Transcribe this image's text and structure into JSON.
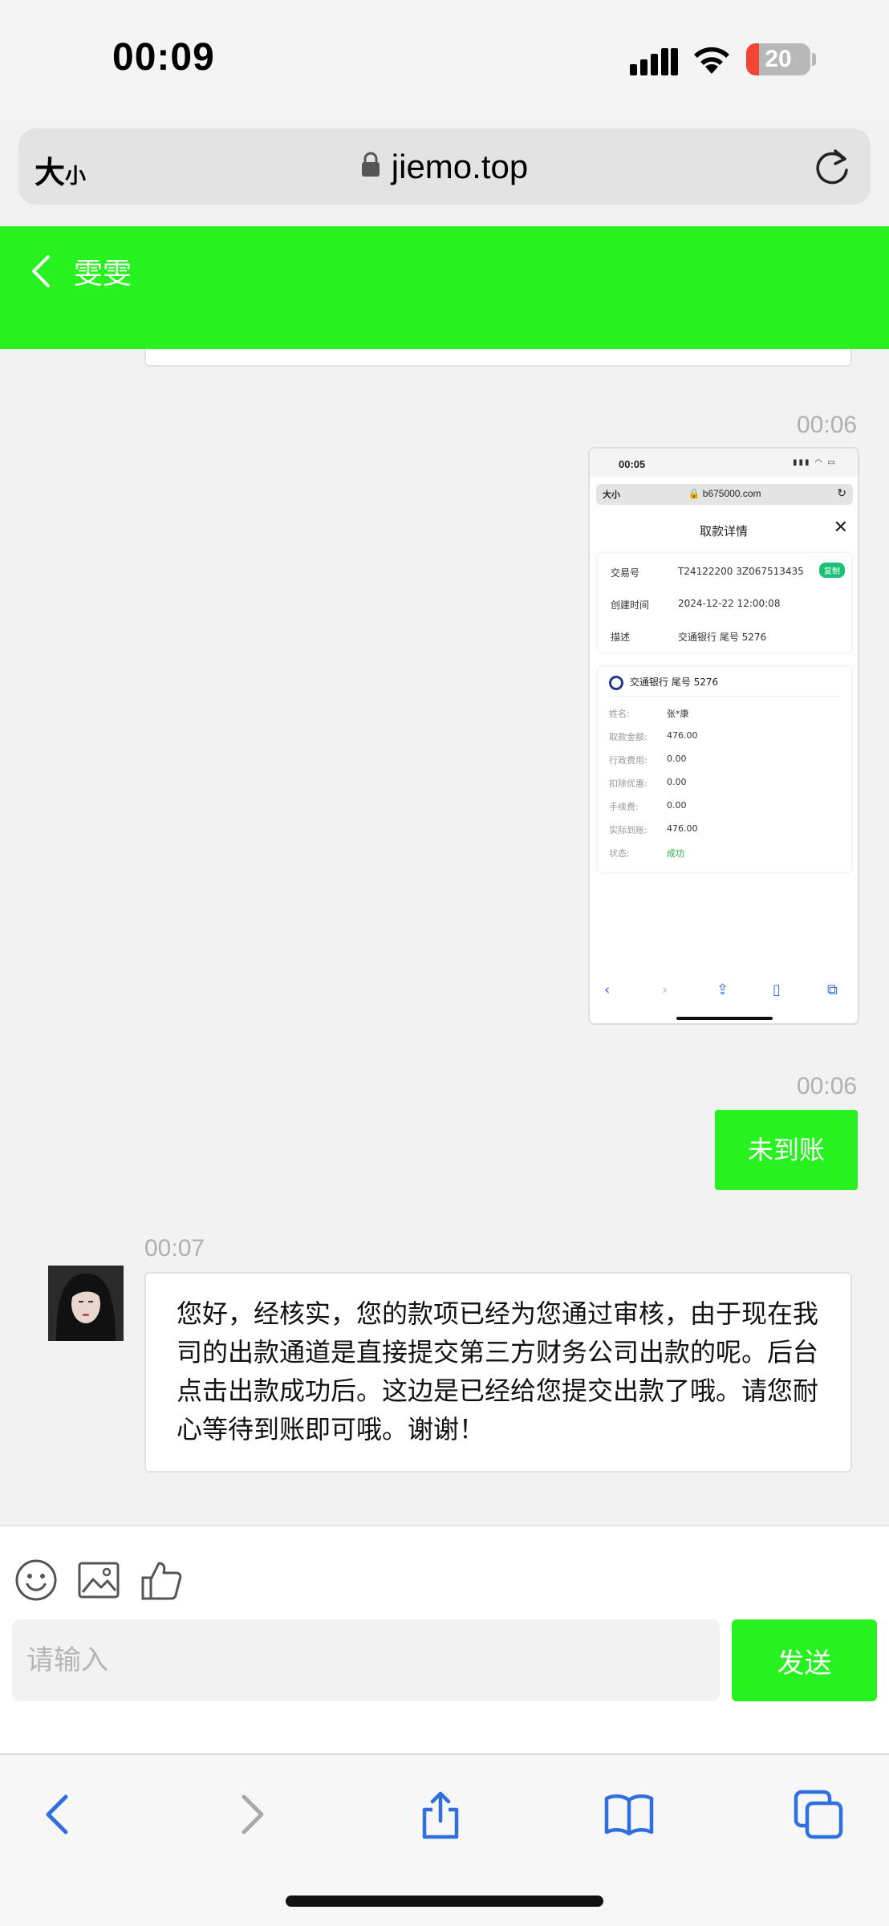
{
  "status_bar": {
    "time": "00:09",
    "battery_level": "20",
    "battery_color": "#f04637"
  },
  "browser": {
    "text_size_large": "大",
    "text_size_small": "小",
    "url": "jiemo.top"
  },
  "chat": {
    "header_color": "#27f11f",
    "title": "雯雯",
    "messages": [
      {
        "time": "00:06",
        "type": "image",
        "from": "me"
      },
      {
        "time": "00:06",
        "type": "text",
        "from": "me",
        "text": "未到账"
      },
      {
        "time": "00:07",
        "type": "text",
        "from": "them",
        "text": "您好，经核实，您的款项已经为您通过审核，由于现在我司的出款通道是直接提交第三方财务公司出款的呢。后台点击出款成功后。这边是已经给您提交出款了哦。请您耐心等待到账即可哦。谢谢！"
      }
    ]
  },
  "embedded_screenshot": {
    "time": "00:05",
    "url": "b675000.com",
    "text_size": "大小",
    "title": "取款详情",
    "copy_label": "复制",
    "details": [
      {
        "label": "交易号",
        "value": "T24122200 3Z067513435"
      },
      {
        "label": "创建时间",
        "value": "2024-12-22 12:00:08"
      },
      {
        "label": "描述",
        "value": "交通银行 尾号 5276"
      }
    ],
    "bank_name": "交通银行 尾号 5276",
    "rows": [
      {
        "label": "姓名:",
        "value": "张*康"
      },
      {
        "label": "取款金额:",
        "value": "476.00"
      },
      {
        "label": "行政费用:",
        "value": "0.00"
      },
      {
        "label": "扣除优惠:",
        "value": "0.00"
      },
      {
        "label": "手续费:",
        "value": "0.00"
      },
      {
        "label": "实际到账:",
        "value": "476.00"
      },
      {
        "label": "状态:",
        "value": "成功"
      }
    ]
  },
  "composer": {
    "placeholder": "请输入",
    "send_label": "发送",
    "icons": [
      "emoji-icon",
      "image-icon",
      "thumbs-up-icon"
    ]
  },
  "safari_toolbar": {
    "icons": [
      "back-icon",
      "forward-icon",
      "share-icon",
      "bookmarks-icon",
      "tabs-icon"
    ],
    "accent": "#2f6fe0"
  }
}
